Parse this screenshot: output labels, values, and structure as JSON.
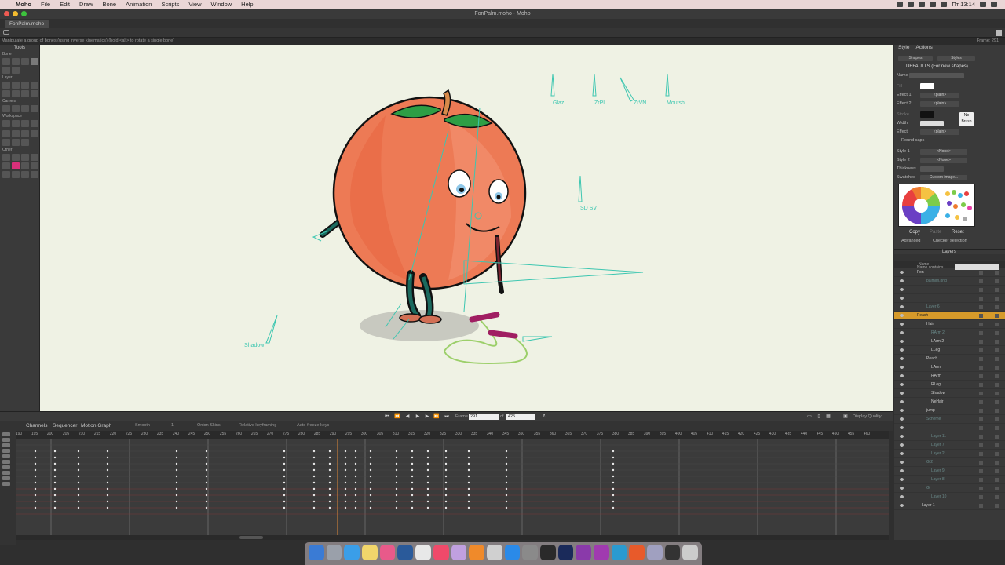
{
  "menubar": {
    "app_name": "Moho",
    "items": [
      "File",
      "Edit",
      "Draw",
      "Bone",
      "Animation",
      "Scripts",
      "View",
      "Window",
      "Help"
    ],
    "clock": "Пт 13:14"
  },
  "window": {
    "title": "FonPalm.moho - Moho",
    "tab": "FonPalm.moho",
    "status_hint": "Manipulate a group of bones (using inverse kinematics) (hold <alt> to rotate a single bone)",
    "frame_info": "Frame: 291"
  },
  "tools": {
    "header": "Tools",
    "sections": [
      "Bone",
      "Layer",
      "Camera",
      "Workspace",
      "Other"
    ]
  },
  "canvas": {
    "bone_labels": [
      "Glaz",
      "ZrPL",
      "ZrVN",
      "Moutsh",
      "SD SV",
      "Shadow"
    ]
  },
  "playback": {
    "frame_label": "Frame",
    "frame_value": "291",
    "of_label": "of",
    "total_frames": "425",
    "display_quality": "Display Quality"
  },
  "timeline": {
    "tabs": [
      "Channels",
      "Sequencer",
      "Motion Graph"
    ],
    "interp": "Smooth",
    "interp_num": "1",
    "onion": "Onion Skins",
    "relative": "Relative keyframing",
    "autofreeze": "Auto-freeze keys",
    "ruler": [
      "190",
      "195",
      "200",
      "205",
      "210",
      "215",
      "220",
      "225",
      "230",
      "235",
      "240",
      "245",
      "250",
      "255",
      "260",
      "265",
      "270",
      "275",
      "280",
      "285",
      "290",
      "295",
      "300",
      "305",
      "310",
      "315",
      "320",
      "325",
      "330",
      "335",
      "340",
      "345",
      "350",
      "355",
      "360",
      "365",
      "370",
      "375",
      "380",
      "385",
      "390",
      "395",
      "400",
      "405",
      "410",
      "415",
      "420",
      "425",
      "430",
      "435",
      "440",
      "445",
      "450",
      "455",
      "460"
    ]
  },
  "style_panel": {
    "tabs": [
      "Style",
      "Actions"
    ],
    "shapes": "Shapes",
    "styles": "Styles",
    "defaults": "DEFAULTS (For new shapes)",
    "name_label": "Name",
    "fill_label": "Fill",
    "effect1_label": "Effect 1",
    "effect1_value": "<plain>",
    "effect2_label": "Effect 2",
    "effect2_value": "<plain>",
    "stroke_label": "Stroke",
    "width_label": "Width",
    "effect_label": "Effect",
    "effect_value": "<plain>",
    "no_brush": "No Brush",
    "round_caps": "Round caps",
    "style1_label": "Style 1",
    "style1_value": "<None>",
    "style2_label": "Style 2",
    "style2_value": "<None>",
    "thickness_label": "Thickness",
    "swatches_label": "Swatches",
    "swatches_value": "Custom image...",
    "copy": "Copy",
    "paste": "Paste",
    "reset": "Reset",
    "advanced": "Advanced",
    "checker": "Checker selection"
  },
  "layers": {
    "title": "Layers",
    "filter": "Name contains",
    "name_col": "Name",
    "rows": [
      {
        "name": "Fon",
        "indent": 30,
        "state": "normal"
      },
      {
        "name": "palmim.png",
        "indent": 42,
        "state": "dim"
      },
      {
        "name": "",
        "indent": 42,
        "state": "dim"
      },
      {
        "name": "",
        "indent": 42,
        "state": "dim"
      },
      {
        "name": "Layer 6",
        "indent": 42,
        "state": "dim"
      },
      {
        "name": "Peach",
        "indent": 30,
        "state": "sel"
      },
      {
        "name": "Hair",
        "indent": 42,
        "state": "normal"
      },
      {
        "name": "RArm 2",
        "indent": 48,
        "state": "dim"
      },
      {
        "name": "LArm 2",
        "indent": 48,
        "state": "normal"
      },
      {
        "name": "LLeg",
        "indent": 48,
        "state": "normal"
      },
      {
        "name": "Peach",
        "indent": 42,
        "state": "normal"
      },
      {
        "name": "LArm",
        "indent": 48,
        "state": "normal"
      },
      {
        "name": "RArm",
        "indent": 48,
        "state": "normal"
      },
      {
        "name": "RLeg",
        "indent": 48,
        "state": "normal"
      },
      {
        "name": "Shadow",
        "indent": 48,
        "state": "normal"
      },
      {
        "name": "NeHair",
        "indent": 48,
        "state": "normal"
      },
      {
        "name": "jump",
        "indent": 42,
        "state": "normal"
      },
      {
        "name": "Scheme",
        "indent": 42,
        "state": "dim"
      },
      {
        "name": "",
        "indent": 42,
        "state": "dim"
      },
      {
        "name": "Layer 11",
        "indent": 48,
        "state": "dim"
      },
      {
        "name": "Layer 7",
        "indent": 48,
        "state": "dim"
      },
      {
        "name": "Layer 2",
        "indent": 48,
        "state": "dim"
      },
      {
        "name": "G 2",
        "indent": 42,
        "state": "dim"
      },
      {
        "name": "Layer 9",
        "indent": 48,
        "state": "dim"
      },
      {
        "name": "Layer 8",
        "indent": 48,
        "state": "dim"
      },
      {
        "name": "G",
        "indent": 42,
        "state": "dim"
      },
      {
        "name": "Layer 10",
        "indent": 48,
        "state": "dim"
      },
      {
        "name": "Layer 1",
        "indent": 36,
        "state": "normal"
      }
    ]
  },
  "colors": {
    "canvas_bg": "#eff2e4",
    "peach": "#ed7a55",
    "bone": "#3cc6b0",
    "layer_selected": "#d69a2a"
  }
}
